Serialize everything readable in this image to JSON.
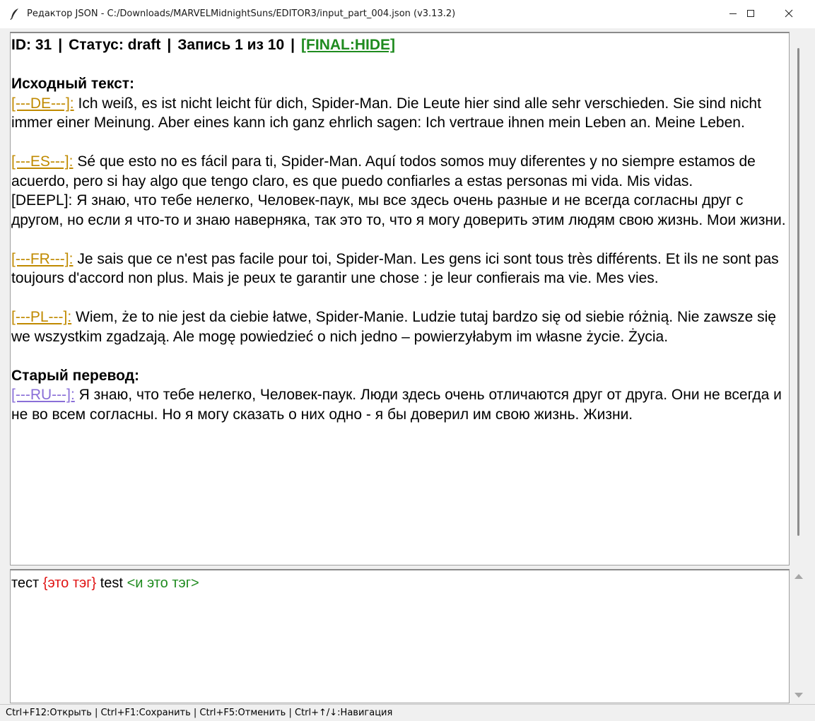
{
  "window": {
    "title": "Редактор JSON - C:/Downloads/MARVELMidnightSuns/EDITOR3/input_part_004.json (v3.13.2)",
    "icon": "feather-icon"
  },
  "header": {
    "id": "ID: 31",
    "sep": "|",
    "status": "Статус: draft",
    "record": "Запись 1 из 10",
    "final_tag": "[FINAL:HIDE]"
  },
  "source": {
    "title": "Исходный текст:",
    "de_tag": "[---DE---]:",
    "de_text": "Ich weiß, es ist nicht leicht für dich, Spider-Man. Die Leute hier sind alle sehr verschieden. Sie sind nicht immer einer Meinung. Aber eines kann ich ganz ehrlich sagen: Ich vertraue ihnen mein Leben an. Meine Leben.",
    "es_tag": "[---ES---]:",
    "es_text": "Sé que esto no es fácil para ti, Spider-Man. Aquí todos somos muy diferentes y no siempre estamos de acuerdo, pero si hay algo que tengo claro, es que puedo confiarles a estas personas mi vida. Mis vidas.",
    "deepl": "[DEEPL]: Я знаю, что тебе нелегко, Человек-паук, мы все здесь очень разные и не всегда согласны друг с другом, но если я что-то и знаю наверняка, так это то, что я могу доверить этим людям свою жизнь. Мои жизни.",
    "fr_tag": "[---FR---]:",
    "fr_text": "Je sais que ce n'est pas facile pour toi, Spider-Man. Les gens ici sont tous très différents. Et ils ne sont pas toujours d'accord non plus. Mais je peux te garantir une chose : je leur confierais ma vie. Mes vies.",
    "pl_tag": "[---PL---]:",
    "pl_text": "Wiem, że to nie jest da ciebie łatwe, Spider-Manie. Ludzie tutaj bardzo się od siebie różnią. Nie zawsze się we wszystkim zgadzają. Ale mogę powiedzieć o nich jedno – powierzyłabym im własne życie. Życia."
  },
  "old_translation": {
    "title": "Старый перевод:",
    "ru_tag": "[---RU---]:",
    "ru_text": "Я знаю, что тебе нелегко, Человек-паук. Люди здесь очень отличаются друг от друга. Они не всегда и не во всем согласны. Но я могу сказать о них одно - я бы доверил им свою жизнь. Жизни."
  },
  "editor": {
    "t1": "тест",
    "t2": "{это тэг}",
    "t3": "test",
    "t4": "<и это тэг>"
  },
  "statusbar": {
    "text": "Ctrl+F12:Открыть | Ctrl+F1:Сохранить | Ctrl+F5:Отменить | Ctrl+↑/↓:Навигация"
  },
  "colors": {
    "lang_tag": "#c08a00",
    "ru_tag": "#8a6fd8",
    "final_tag": "#1f8b1f",
    "tag_red": "#e01414",
    "tag_green": "#1f8b1f"
  }
}
